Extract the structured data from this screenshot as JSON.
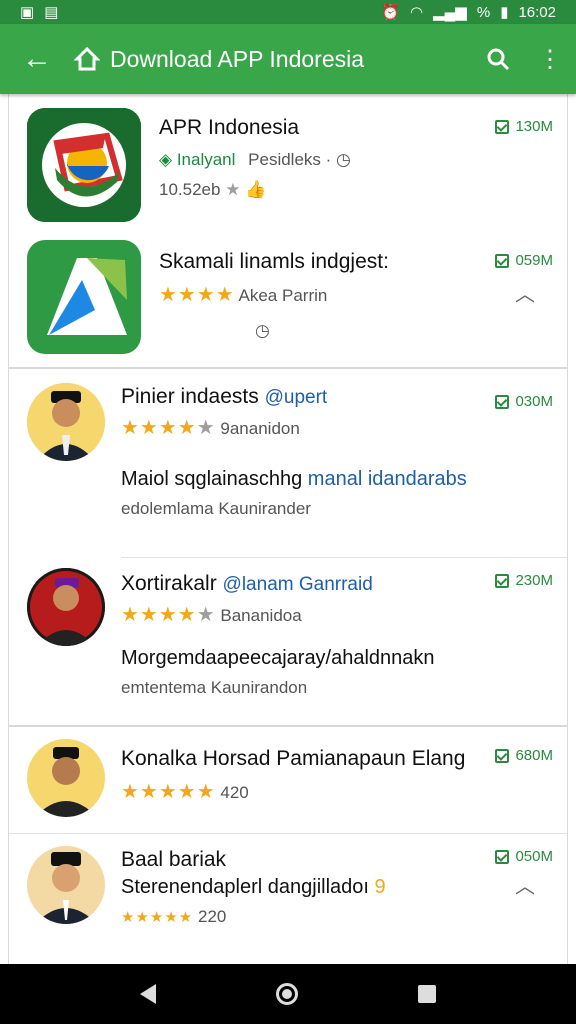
{
  "status_bar": {
    "time": "16:02",
    "battery": "%"
  },
  "app_bar": {
    "title": "Download APP Indoresia"
  },
  "icons": {
    "back": "arrow-left-icon",
    "home": "house-icon",
    "search": "search-icon",
    "more": "more-vert-icon"
  },
  "colors": {
    "status_bar": "#2a8a3e",
    "app_bar": "#3aa64a",
    "star": "#f2a81d",
    "size_text": "#2b8a3e"
  },
  "apps": [
    {
      "title": "APR Indonesia",
      "developer": "Inalyanl",
      "developer_suffix": "Pesidleks ·",
      "meta": "10.52eb",
      "size": "130M"
    },
    {
      "title": "Skamali linamls indgjest:",
      "rating": 4,
      "rating_text": "Akea Parrin",
      "size": "059M"
    }
  ],
  "posts": [
    {
      "title": "Pinier indaests",
      "handle": "@upert",
      "rating_text": "9ananidon",
      "desc_black": "Maiol sqglainaschhg",
      "desc_blue": "manal idandarabs",
      "meta": "edolemlama Kaunirander",
      "size": "030M"
    },
    {
      "title": "Xortirakalr",
      "handle": "@lanam Ganrraid",
      "rating_text": "Bananidoa",
      "desc_black": "Morgemdaapeecajaray/ahaldnnakn",
      "meta": "emtentema Kaunirandon",
      "size": "230M"
    },
    {
      "title": "Konalka Horsad Pamianapaun Elang",
      "rating_text": "420",
      "size": "680M"
    },
    {
      "title": "Baal bariak",
      "title2": "Sterenendaplerl dangjilladoı",
      "title2_accent": "9",
      "rating_text": "220",
      "size": "050M"
    }
  ]
}
